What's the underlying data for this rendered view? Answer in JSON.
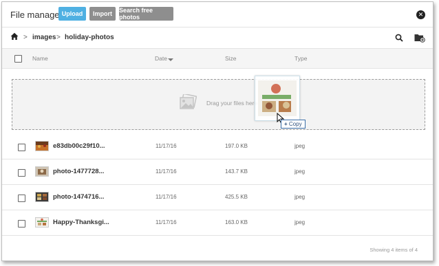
{
  "header": {
    "title": "File manager",
    "upload_label": "Upload",
    "import_label": "Import",
    "search_free_photos_label": "Search free photos",
    "close_icon": "close-icon"
  },
  "breadcrumb": {
    "items": [
      "images",
      "holiday-photos"
    ],
    "separator": ">"
  },
  "columns": {
    "name": "Name",
    "date": "Date",
    "size": "Size",
    "type": "Type"
  },
  "dropzone": {
    "text": "Drag your files here",
    "copy_label": "Copy",
    "copy_prefix": "+"
  },
  "files": [
    {
      "name": "e83db00c29f10...",
      "date": "11/17/16",
      "size": "197.0 KB",
      "type": "jpeg"
    },
    {
      "name": "photo-1477728...",
      "date": "11/17/16",
      "size": "143.7 KB",
      "type": "jpeg"
    },
    {
      "name": "photo-1474716...",
      "date": "11/17/16",
      "size": "425.5 KB",
      "type": "jpeg"
    },
    {
      "name": "Happy-Thanksgi...",
      "date": "11/17/16",
      "size": "163.0 KB",
      "type": "jpeg"
    }
  ],
  "footer": {
    "status": "Showing 4 items of 4"
  },
  "colors": {
    "upload_button": "#4fb0e2",
    "secondary_button": "#8e8e8e",
    "tooltip_border": "#3a6ea8"
  }
}
